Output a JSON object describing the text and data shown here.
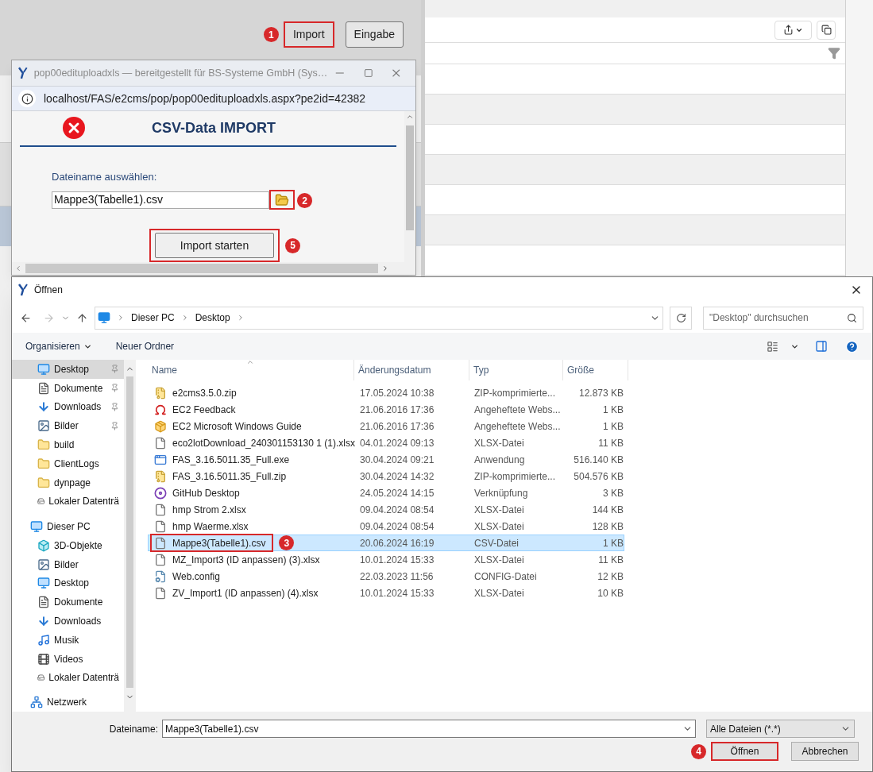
{
  "app": {
    "toolbar_buttons": [
      {
        "label": "Import",
        "step": "1"
      },
      {
        "label": "Eingabe"
      }
    ]
  },
  "popup": {
    "title": "pop00edituploadxls — bereitgestellt für BS-Systeme GmbH (Sys…",
    "url": "localhost/FAS/e2cms/pop/pop00edituploadxls.aspx?pe2id=42382",
    "heading": "CSV-Data IMPORT",
    "field_label": "Dateiname auswählen:",
    "file_value": "Mappe3(Tabelle1).csv",
    "browse_step": "2",
    "start_button": {
      "label": "Import starten",
      "step": "5"
    }
  },
  "open_dialog": {
    "title": "Öffnen",
    "breadcrumb": [
      "Dieser PC",
      "Desktop"
    ],
    "search": {
      "placeholder": "\"Desktop\" durchsuchen"
    },
    "commands": [
      {
        "label": "Organisieren",
        "kind": "menu"
      },
      {
        "label": "Neuer Ordner",
        "kind": "action"
      }
    ],
    "nav": {
      "quick_access": [
        {
          "label": "Desktop",
          "kind": "desktop",
          "pinned": true,
          "selected": true
        },
        {
          "label": "Dokumente",
          "kind": "documents",
          "pinned": true,
          "selected": false
        },
        {
          "label": "Downloads",
          "kind": "downloads",
          "pinned": true,
          "selected": false
        },
        {
          "label": "Bilder",
          "kind": "pictures",
          "pinned": true,
          "selected": false
        },
        {
          "label": "build",
          "kind": "folder",
          "pinned": false,
          "selected": false
        },
        {
          "label": "ClientLogs",
          "kind": "folder",
          "pinned": false,
          "selected": false
        },
        {
          "label": "dynpage",
          "kind": "folder",
          "pinned": false,
          "selected": false
        },
        {
          "label": "Lokaler Datenträ",
          "kind": "drive",
          "pinned": false,
          "selected": false
        }
      ],
      "this_pc": {
        "label": "Dieser PC",
        "kind": "pc",
        "selected": false,
        "children": [
          {
            "label": "3D-Objekte",
            "kind": "objects",
            "selected": false
          },
          {
            "label": "Bilder",
            "kind": "pictures",
            "selected": false
          },
          {
            "label": "Desktop",
            "kind": "desktop",
            "selected": false
          },
          {
            "label": "Dokumente",
            "kind": "documents",
            "selected": false
          },
          {
            "label": "Downloads",
            "kind": "downloads",
            "selected": false
          },
          {
            "label": "Musik",
            "kind": "music",
            "selected": false
          },
          {
            "label": "Videos",
            "kind": "videos",
            "selected": false
          },
          {
            "label": "Lokaler Datenträ",
            "kind": "drive",
            "selected": false
          }
        ]
      },
      "network": {
        "label": "Netzwerk",
        "kind": "network",
        "selected": false
      }
    },
    "columns": [
      "Name",
      "Änderungsdatum",
      "Typ",
      "Größe"
    ],
    "files": [
      {
        "name": "e2cms3.5.0.zip",
        "date": "17.05.2024 10:38",
        "type": "ZIP-komprimierte...",
        "size": "12.873 KB",
        "kind": "zip",
        "selected": false
      },
      {
        "name": "EC2 Feedback",
        "date": "21.06.2016 17:36",
        "type": "Angeheftete Webs...",
        "size": "1 KB",
        "kind": "feedback-link",
        "selected": false
      },
      {
        "name": "EC2 Microsoft Windows Guide",
        "date": "21.06.2016 17:36",
        "type": "Angeheftete Webs...",
        "size": "1 KB",
        "kind": "guide-link",
        "selected": false
      },
      {
        "name": "eco2lotDownload_240301153130 1 (1).xlsx",
        "date": "04.01.2024 09:13",
        "type": "XLSX-Datei",
        "size": "11 KB",
        "kind": "file",
        "selected": false
      },
      {
        "name": "FAS_3.16.5011.35_Full.exe",
        "date": "30.04.2024 09:21",
        "type": "Anwendung",
        "size": "516.140 KB",
        "kind": "exe",
        "selected": false
      },
      {
        "name": "FAS_3.16.5011.35_Full.zip",
        "date": "30.04.2024 14:32",
        "type": "ZIP-komprimierte...",
        "size": "504.576 KB",
        "kind": "zip",
        "selected": false
      },
      {
        "name": "GitHub Desktop",
        "date": "24.05.2024 14:15",
        "type": "Verknüpfung",
        "size": "3 KB",
        "kind": "github-link",
        "selected": false
      },
      {
        "name": "hmp Strom 2.xlsx",
        "date": "09.04.2024 08:54",
        "type": "XLSX-Datei",
        "size": "144 KB",
        "kind": "file",
        "selected": false
      },
      {
        "name": "hmp Waerme.xlsx",
        "date": "09.04.2024 08:54",
        "type": "XLSX-Datei",
        "size": "128 KB",
        "kind": "file",
        "selected": false
      },
      {
        "name": "Mappe3(Tabelle1).csv",
        "date": "20.06.2024 16:19",
        "type": "CSV-Datei",
        "size": "1 KB",
        "kind": "file",
        "selected": true,
        "step": "3"
      },
      {
        "name": "MZ_Import3 (ID anpassen) (3).xlsx",
        "date": "10.01.2024 15:33",
        "type": "XLSX-Datei",
        "size": "11 KB",
        "kind": "file",
        "selected": false
      },
      {
        "name": "Web.config",
        "date": "22.03.2023 11:56",
        "type": "CONFIG-Datei",
        "size": "12 KB",
        "kind": "config",
        "selected": false
      },
      {
        "name": "ZV_Import1 (ID anpassen) (4).xlsx",
        "date": "10.01.2024 15:33",
        "type": "XLSX-Datei",
        "size": "10 KB",
        "kind": "file",
        "selected": false
      }
    ],
    "filename_label": "Dateiname:",
    "filename_value": "Mappe3(Tabelle1).csv",
    "filetype": "Alle Dateien (*.*)",
    "buttons": [
      {
        "label": "Öffnen",
        "step": "4"
      },
      {
        "label": "Abbrechen"
      }
    ]
  }
}
